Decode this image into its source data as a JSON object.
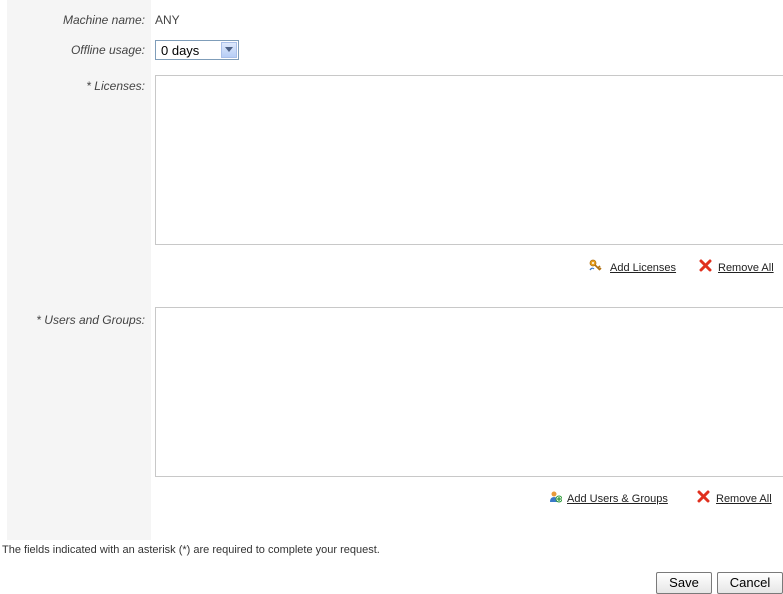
{
  "form": {
    "machine_name_label": "Machine name:",
    "machine_name_value": "ANY",
    "offline_usage_label": "Offline usage:",
    "offline_usage_value": "0 days",
    "licenses_label": "* Licenses:",
    "users_groups_label": "* Users and Groups:"
  },
  "licenses_actions": {
    "add_label": "Add Licenses",
    "add_icon": "key-icon",
    "remove_label": "Remove All",
    "remove_icon": "red-x-icon"
  },
  "users_actions": {
    "add_label": "Add Users & Groups",
    "add_icon": "users-add-icon",
    "remove_label": "Remove All",
    "remove_icon": "red-x-icon"
  },
  "footer": {
    "required_note": "The fields indicated with an asterisk (*) are required to complete your request.",
    "save_label": "Save",
    "cancel_label": "Cancel"
  },
  "colors": {
    "label_column_bg": "#f5f5f5",
    "remove_icon": "#e0301e",
    "key_icon": "#e8a020"
  }
}
